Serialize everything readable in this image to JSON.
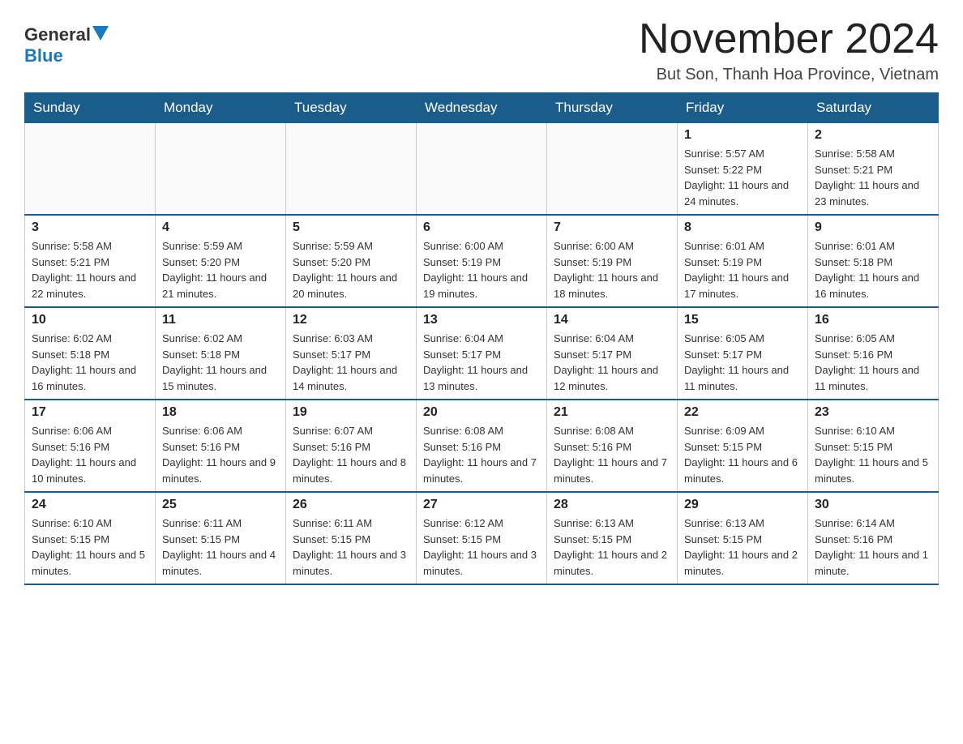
{
  "header": {
    "logo_general": "General",
    "logo_blue": "Blue",
    "month_title": "November 2024",
    "location": "But Son, Thanh Hoa Province, Vietnam"
  },
  "days_of_week": [
    "Sunday",
    "Monday",
    "Tuesday",
    "Wednesday",
    "Thursday",
    "Friday",
    "Saturday"
  ],
  "weeks": [
    [
      {
        "day": "",
        "info": ""
      },
      {
        "day": "",
        "info": ""
      },
      {
        "day": "",
        "info": ""
      },
      {
        "day": "",
        "info": ""
      },
      {
        "day": "",
        "info": ""
      },
      {
        "day": "1",
        "info": "Sunrise: 5:57 AM\nSunset: 5:22 PM\nDaylight: 11 hours and 24 minutes."
      },
      {
        "day": "2",
        "info": "Sunrise: 5:58 AM\nSunset: 5:21 PM\nDaylight: 11 hours and 23 minutes."
      }
    ],
    [
      {
        "day": "3",
        "info": "Sunrise: 5:58 AM\nSunset: 5:21 PM\nDaylight: 11 hours and 22 minutes."
      },
      {
        "day": "4",
        "info": "Sunrise: 5:59 AM\nSunset: 5:20 PM\nDaylight: 11 hours and 21 minutes."
      },
      {
        "day": "5",
        "info": "Sunrise: 5:59 AM\nSunset: 5:20 PM\nDaylight: 11 hours and 20 minutes."
      },
      {
        "day": "6",
        "info": "Sunrise: 6:00 AM\nSunset: 5:19 PM\nDaylight: 11 hours and 19 minutes."
      },
      {
        "day": "7",
        "info": "Sunrise: 6:00 AM\nSunset: 5:19 PM\nDaylight: 11 hours and 18 minutes."
      },
      {
        "day": "8",
        "info": "Sunrise: 6:01 AM\nSunset: 5:19 PM\nDaylight: 11 hours and 17 minutes."
      },
      {
        "day": "9",
        "info": "Sunrise: 6:01 AM\nSunset: 5:18 PM\nDaylight: 11 hours and 16 minutes."
      }
    ],
    [
      {
        "day": "10",
        "info": "Sunrise: 6:02 AM\nSunset: 5:18 PM\nDaylight: 11 hours and 16 minutes."
      },
      {
        "day": "11",
        "info": "Sunrise: 6:02 AM\nSunset: 5:18 PM\nDaylight: 11 hours and 15 minutes."
      },
      {
        "day": "12",
        "info": "Sunrise: 6:03 AM\nSunset: 5:17 PM\nDaylight: 11 hours and 14 minutes."
      },
      {
        "day": "13",
        "info": "Sunrise: 6:04 AM\nSunset: 5:17 PM\nDaylight: 11 hours and 13 minutes."
      },
      {
        "day": "14",
        "info": "Sunrise: 6:04 AM\nSunset: 5:17 PM\nDaylight: 11 hours and 12 minutes."
      },
      {
        "day": "15",
        "info": "Sunrise: 6:05 AM\nSunset: 5:17 PM\nDaylight: 11 hours and 11 minutes."
      },
      {
        "day": "16",
        "info": "Sunrise: 6:05 AM\nSunset: 5:16 PM\nDaylight: 11 hours and 11 minutes."
      }
    ],
    [
      {
        "day": "17",
        "info": "Sunrise: 6:06 AM\nSunset: 5:16 PM\nDaylight: 11 hours and 10 minutes."
      },
      {
        "day": "18",
        "info": "Sunrise: 6:06 AM\nSunset: 5:16 PM\nDaylight: 11 hours and 9 minutes."
      },
      {
        "day": "19",
        "info": "Sunrise: 6:07 AM\nSunset: 5:16 PM\nDaylight: 11 hours and 8 minutes."
      },
      {
        "day": "20",
        "info": "Sunrise: 6:08 AM\nSunset: 5:16 PM\nDaylight: 11 hours and 7 minutes."
      },
      {
        "day": "21",
        "info": "Sunrise: 6:08 AM\nSunset: 5:16 PM\nDaylight: 11 hours and 7 minutes."
      },
      {
        "day": "22",
        "info": "Sunrise: 6:09 AM\nSunset: 5:15 PM\nDaylight: 11 hours and 6 minutes."
      },
      {
        "day": "23",
        "info": "Sunrise: 6:10 AM\nSunset: 5:15 PM\nDaylight: 11 hours and 5 minutes."
      }
    ],
    [
      {
        "day": "24",
        "info": "Sunrise: 6:10 AM\nSunset: 5:15 PM\nDaylight: 11 hours and 5 minutes."
      },
      {
        "day": "25",
        "info": "Sunrise: 6:11 AM\nSunset: 5:15 PM\nDaylight: 11 hours and 4 minutes."
      },
      {
        "day": "26",
        "info": "Sunrise: 6:11 AM\nSunset: 5:15 PM\nDaylight: 11 hours and 3 minutes."
      },
      {
        "day": "27",
        "info": "Sunrise: 6:12 AM\nSunset: 5:15 PM\nDaylight: 11 hours and 3 minutes."
      },
      {
        "day": "28",
        "info": "Sunrise: 6:13 AM\nSunset: 5:15 PM\nDaylight: 11 hours and 2 minutes."
      },
      {
        "day": "29",
        "info": "Sunrise: 6:13 AM\nSunset: 5:15 PM\nDaylight: 11 hours and 2 minutes."
      },
      {
        "day": "30",
        "info": "Sunrise: 6:14 AM\nSunset: 5:16 PM\nDaylight: 11 hours and 1 minute."
      }
    ]
  ]
}
